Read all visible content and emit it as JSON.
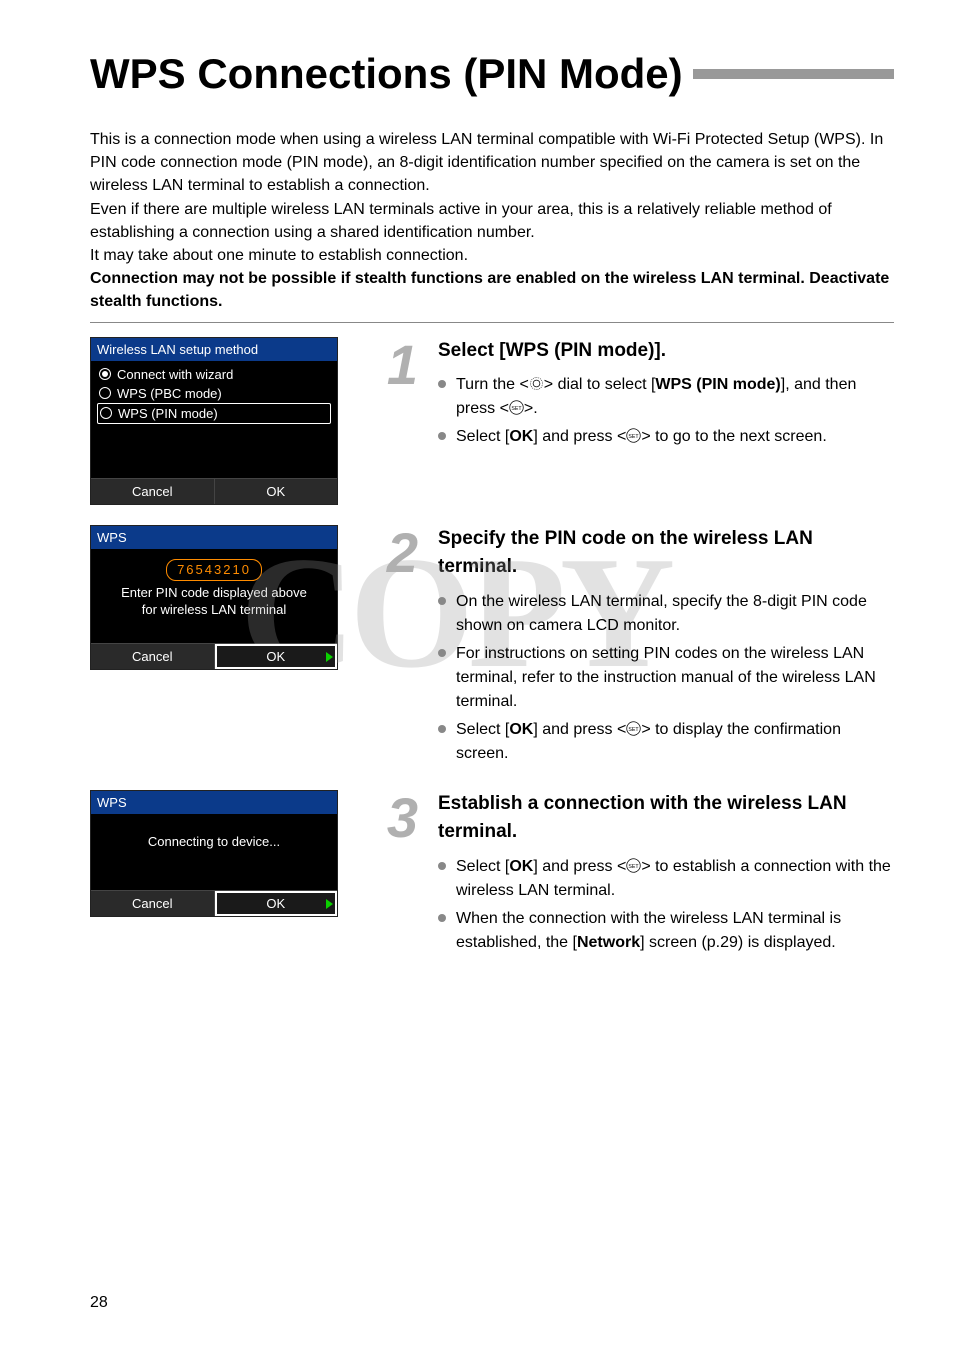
{
  "title": "WPS Connections (PIN Mode)",
  "intro": {
    "p1": "This is a connection mode when using a wireless LAN terminal compatible with Wi-Fi Protected Setup (WPS). In PIN code connection mode (PIN mode), an 8-digit identification number specified on the camera is set on the wireless LAN terminal to establish a connection.",
    "p2": "Even if there are multiple wireless LAN terminals active in your area, this is a relatively reliable method of establishing a connection using a shared identification number.",
    "p3": "It may take about one minute to establish connection.",
    "warn": "Connection may not be possible if stealth functions are enabled on the wireless LAN terminal. Deactivate stealth functions."
  },
  "lcd1": {
    "title": "Wireless LAN setup method",
    "opt1": "Connect with wizard",
    "opt2": "WPS (PBC mode)",
    "opt3": "WPS (PIN mode)",
    "cancel": "Cancel",
    "ok": "OK"
  },
  "lcd2": {
    "title": "WPS",
    "pin": "76543210",
    "line1": "Enter PIN code displayed above",
    "line2": "for wireless LAN terminal",
    "cancel": "Cancel",
    "ok": "OK"
  },
  "lcd3": {
    "title": "WPS",
    "msg": "Connecting to device...",
    "cancel": "Cancel",
    "ok": "OK"
  },
  "steps": {
    "s1": {
      "num": "1",
      "heading": "Select [WPS (PIN mode)].",
      "b1a": "Turn the <",
      "b1b": "> dial to select [",
      "b1c": "WPS (PIN mode)",
      "b1d": "], and then press <",
      "b1e": ">.",
      "b2a": "Select [",
      "b2b": "OK",
      "b2c": "] and press <",
      "b2d": "> to go to the next screen."
    },
    "s2": {
      "num": "2",
      "heading": "Specify the PIN code on the wireless LAN terminal.",
      "b1": "On the wireless LAN terminal, specify the 8-digit PIN code shown on camera LCD monitor.",
      "b2": "For instructions on setting PIN codes on the wireless LAN terminal, refer to the instruction manual of the wireless LAN terminal.",
      "b3a": "Select [",
      "b3b": "OK",
      "b3c": "] and press <",
      "b3d": "> to display the confirmation screen."
    },
    "s3": {
      "num": "3",
      "heading": "Establish a connection with the wireless LAN terminal.",
      "b1a": "Select [",
      "b1b": "OK",
      "b1c": "] and press <",
      "b1d": "> to establish a connection with the wireless LAN terminal.",
      "b2a": "When the connection with the wireless LAN terminal is established, the [",
      "b2b": "Network",
      "b2c": "] screen (p.29) is displayed."
    }
  },
  "watermark": "COPY",
  "page_number": "28"
}
